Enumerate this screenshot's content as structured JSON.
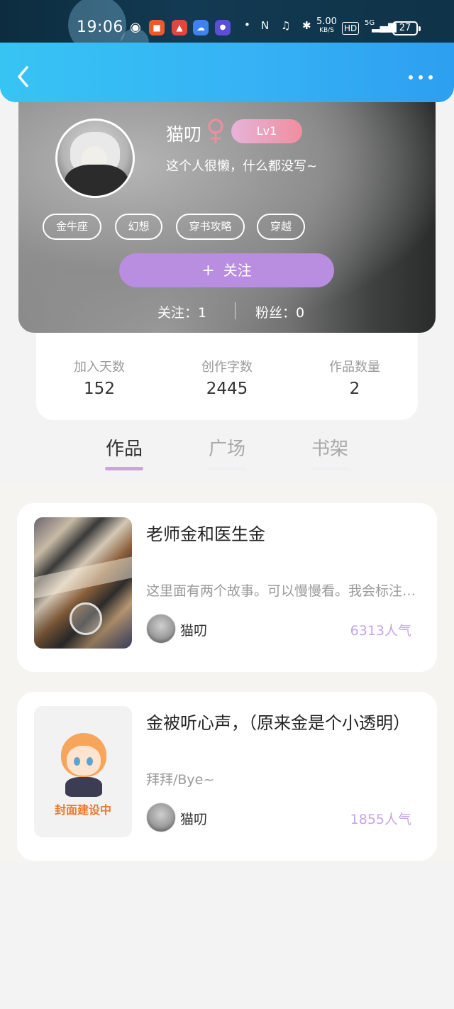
{
  "status_bar": {
    "time": "19:06",
    "net_speed": "5.00",
    "net_unit": "KB/S",
    "hd": "HD",
    "signal": "5G",
    "battery": "27"
  },
  "header": {
    "back_icon": "chevron-left-icon",
    "more_icon": "more-dots-icon"
  },
  "profile": {
    "name": "猫叨",
    "gender_icon": "female-icon",
    "level": "Lv1",
    "bio": "这个人很懒，什么都没写~",
    "tags": [
      "金牛座",
      "幻想",
      "穿书攻略",
      "穿越"
    ],
    "follow_button": "关注",
    "following_label": "关注：1",
    "fans_label": "粉丝：0"
  },
  "stats": [
    {
      "label": "加入天数",
      "value": "152"
    },
    {
      "label": "创作字数",
      "value": "2445"
    },
    {
      "label": "作品数量",
      "value": "2"
    }
  ],
  "tabs": [
    {
      "label": "作品",
      "active": true
    },
    {
      "label": "广场",
      "active": false
    },
    {
      "label": "书架",
      "active": false
    }
  ],
  "works": [
    {
      "title": "老师金和医生金",
      "description": "这里面有两个故事。可以慢慢看。我会标注好的。",
      "author": "猫叨",
      "popularity": "6313人气"
    },
    {
      "title": "金被听心声，（原来金是个小透明）",
      "description": "拜拜/Bye~",
      "author": "猫叨",
      "popularity": "1855人气",
      "cover_caption": "封面建设中"
    }
  ],
  "colors": {
    "header_blue": "#36b2f5",
    "accent_purple": "#c8a4e6",
    "follow_button": "#b98de0",
    "level_badge": "#f08ea0"
  }
}
